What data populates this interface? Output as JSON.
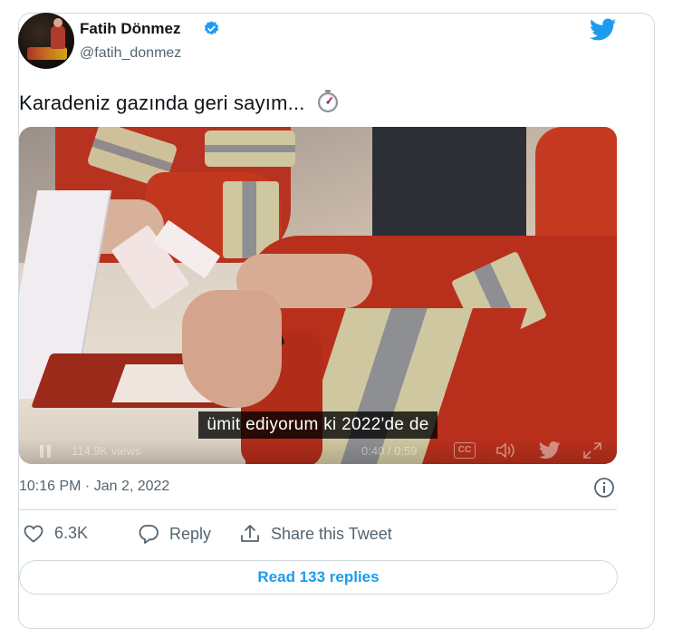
{
  "author": {
    "name": "Fatih Dönmez",
    "handle": "@fatih_donmez",
    "verified": true
  },
  "tweet": {
    "text": "Karadeniz gazında geri sayım...",
    "emoji_icon": "stopwatch-icon"
  },
  "video": {
    "caption": "ümit ediyorum ki 2022'de de",
    "views": "114.9K views",
    "time": "0:40 / 0:59",
    "cc_label": "CC"
  },
  "meta": {
    "timestamp": "10:16 PM · Jan 2, 2022"
  },
  "actions": {
    "like_count": "6.3K",
    "reply_label": "Reply",
    "share_label": "Share this Tweet"
  },
  "read_replies_label": "Read 133 replies",
  "colors": {
    "twitter_blue": "#1d9bf0",
    "secondary_text": "#536471",
    "border": "#cfd9de"
  }
}
